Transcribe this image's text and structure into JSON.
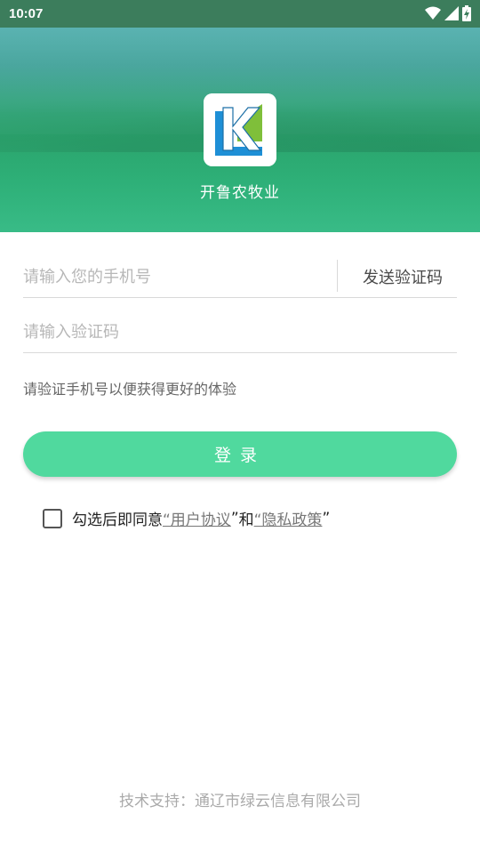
{
  "status_bar": {
    "time": "10:07",
    "icons": [
      "wifi-icon",
      "signal-icon",
      "battery-charging-icon"
    ]
  },
  "header": {
    "app_name": "开鲁农牧业",
    "logo_letter": "K"
  },
  "form": {
    "phone_placeholder": "请输入您的手机号",
    "phone_value": "",
    "send_code_label": "发送验证码",
    "code_placeholder": "请输入验证码",
    "code_value": "",
    "hint": "请验证手机号以便获得更好的体验",
    "login_label": "登录"
  },
  "agreement": {
    "checked": false,
    "prefix": "勾选后即同意",
    "user_agreement": "“用户协议",
    "quote_close_1": "”",
    "and": "和",
    "privacy_policy": "“隐私政策",
    "quote_close_2": "”"
  },
  "footer": {
    "support_text": "技术支持：通辽市绿云信息有限公司"
  },
  "colors": {
    "accent": "#50d99e",
    "status_bar": "#3c7d5c",
    "logo_blue": "#1e8fd6",
    "logo_green": "#7fbf3a"
  }
}
